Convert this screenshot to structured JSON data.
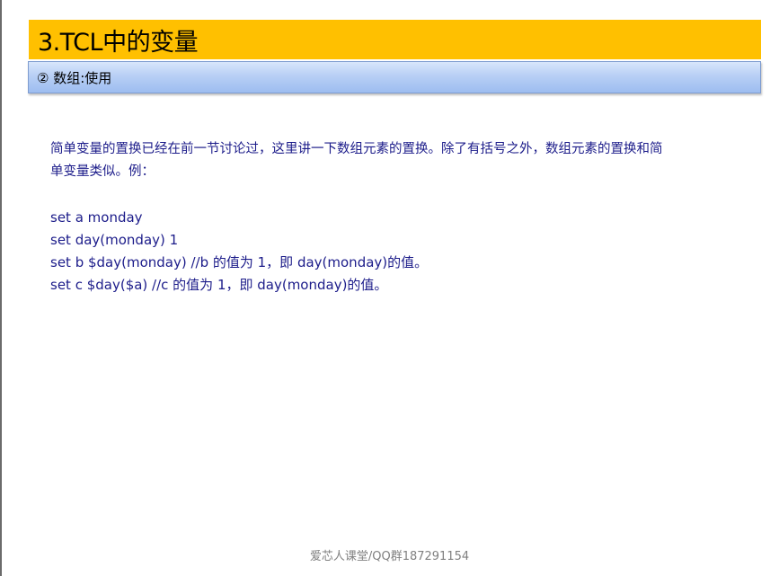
{
  "slide": {
    "title": "3.TCL中的变量",
    "subtitle": "② 数组:使用",
    "paragraph": "简单变量的置换已经在前一节讨论过，这里讲一下数组元素的置换。除了有括号之外，数组元素的置换和简单变量类似。例：",
    "code_lines": [
      "set a monday",
      "set day(monday) 1",
      "set b $day(monday) //b 的值为 1，即 day(monday)的值。",
      "set c $day($a) //c 的值为 1，即 day(monday)的值。"
    ],
    "footer": "爱芯人课堂/QQ群187291154"
  },
  "colors": {
    "title_bar": "#ffc000",
    "subtitle_bar": "#b8cff5",
    "body_text": "#1c1c8a",
    "footer_text": "#808080"
  }
}
